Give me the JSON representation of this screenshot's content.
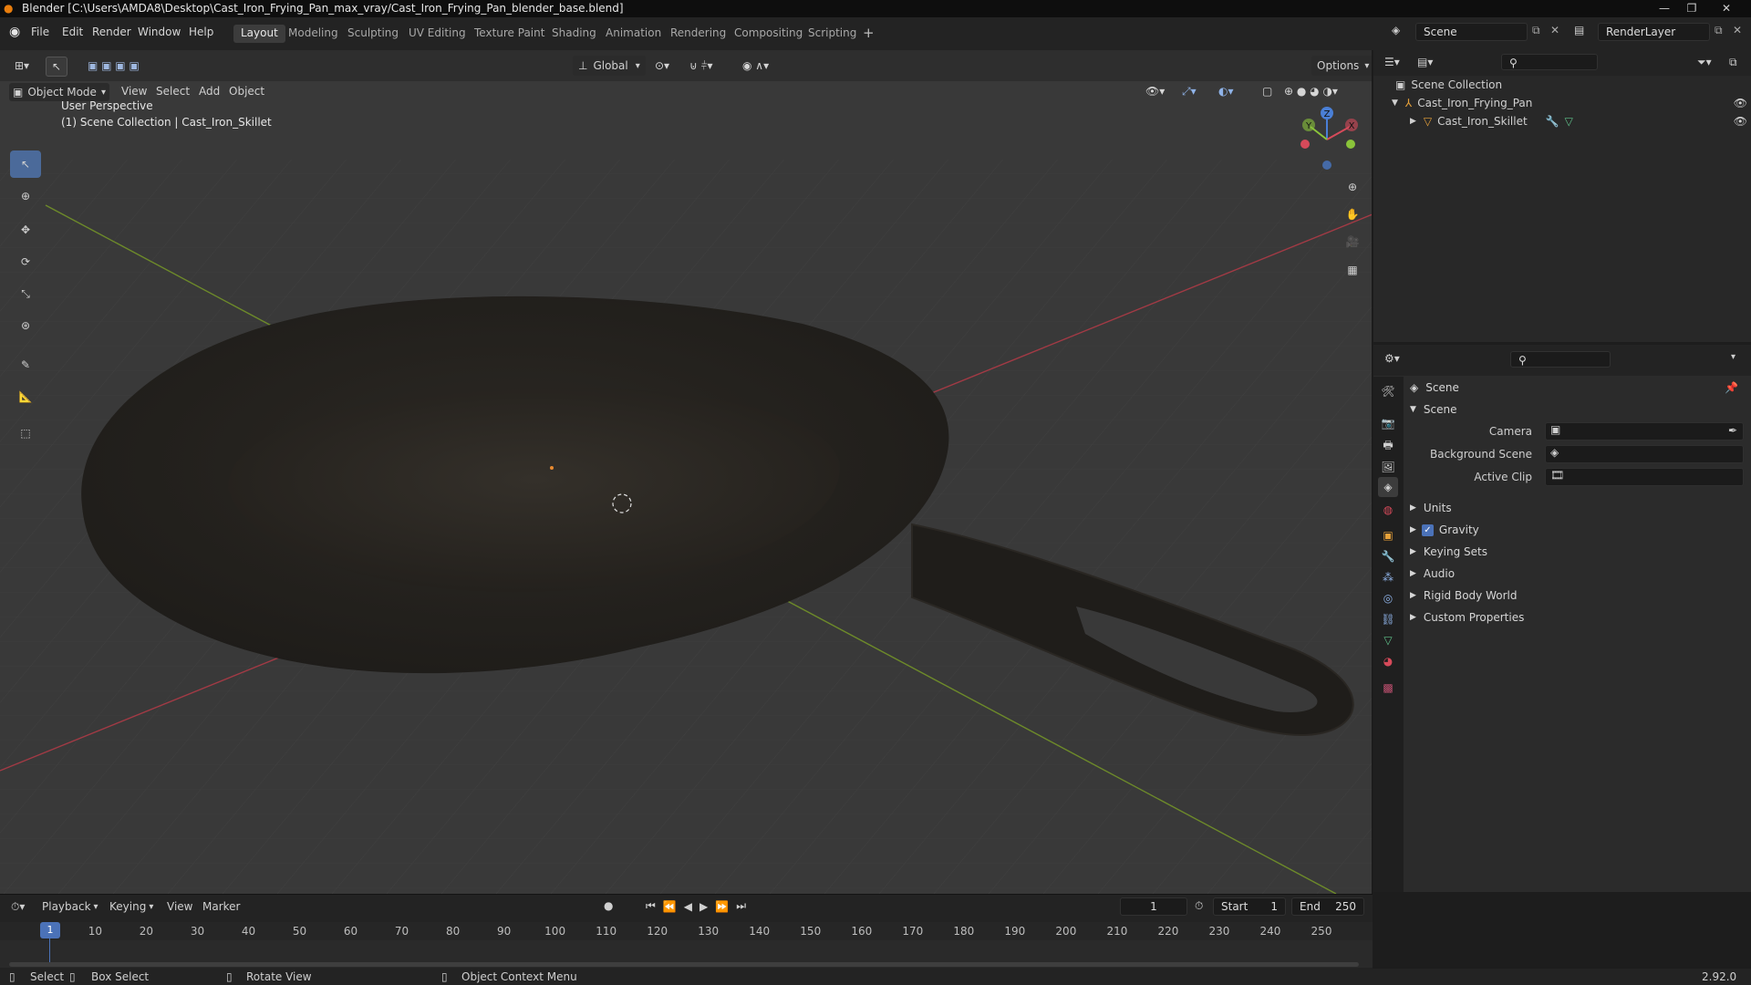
{
  "window": {
    "title": "Blender [C:\\Users\\AMDA8\\Desktop\\Cast_Iron_Frying_Pan_max_vray/Cast_Iron_Frying_Pan_blender_base.blend]"
  },
  "menubar": {
    "items": [
      "File",
      "Edit",
      "Render",
      "Window",
      "Help"
    ]
  },
  "workspaces": [
    {
      "label": "Layout",
      "active": true
    },
    {
      "label": "Modeling"
    },
    {
      "label": "Sculpting"
    },
    {
      "label": "UV Editing"
    },
    {
      "label": "Texture Paint"
    },
    {
      "label": "Shading"
    },
    {
      "label": "Animation"
    },
    {
      "label": "Rendering"
    },
    {
      "label": "Compositing"
    },
    {
      "label": "Scripting"
    }
  ],
  "scene_selector": {
    "value": "Scene"
  },
  "view_layer": {
    "value": "RenderLayer"
  },
  "viewport": {
    "mode": "Object Mode",
    "menus": [
      "View",
      "Select",
      "Add",
      "Object"
    ],
    "transform_orientation": "Global",
    "options_label": "Options",
    "overlay_title": "User Perspective",
    "overlay_subtitle": "(1) Scene Collection | Cast_Iron_Skillet",
    "gizmo": {
      "x": "X",
      "y": "Y",
      "z": "Z"
    }
  },
  "outliner": {
    "root": "Scene Collection",
    "items": [
      {
        "label": "Cast_Iron_Frying_Pan"
      },
      {
        "label": "Cast_Iron_Skillet"
      }
    ]
  },
  "properties": {
    "header": "Scene",
    "panel": "Scene",
    "fields": [
      {
        "label": "Camera"
      },
      {
        "label": "Background Scene"
      },
      {
        "label": "Active Clip"
      }
    ],
    "sections": [
      "Units",
      "Gravity",
      "Keying Sets",
      "Audio",
      "Rigid Body World",
      "Custom Properties"
    ],
    "gravity_checked": true
  },
  "timeline": {
    "menus": [
      "Playback",
      "Keying",
      "View",
      "Marker"
    ],
    "current_frame": "1",
    "start_label": "Start",
    "start": "1",
    "end_label": "End",
    "end": "250",
    "ticks": [
      "1",
      "10",
      "20",
      "30",
      "40",
      "50",
      "60",
      "70",
      "80",
      "90",
      "100",
      "110",
      "120",
      "130",
      "140",
      "150",
      "160",
      "170",
      "180",
      "190",
      "200",
      "210",
      "220",
      "230",
      "240",
      "250"
    ]
  },
  "statusbar": {
    "select": "Select",
    "box_select": "Box Select",
    "rotate_view": "Rotate View",
    "context_menu": "Object Context Menu",
    "version": "2.92.0"
  }
}
